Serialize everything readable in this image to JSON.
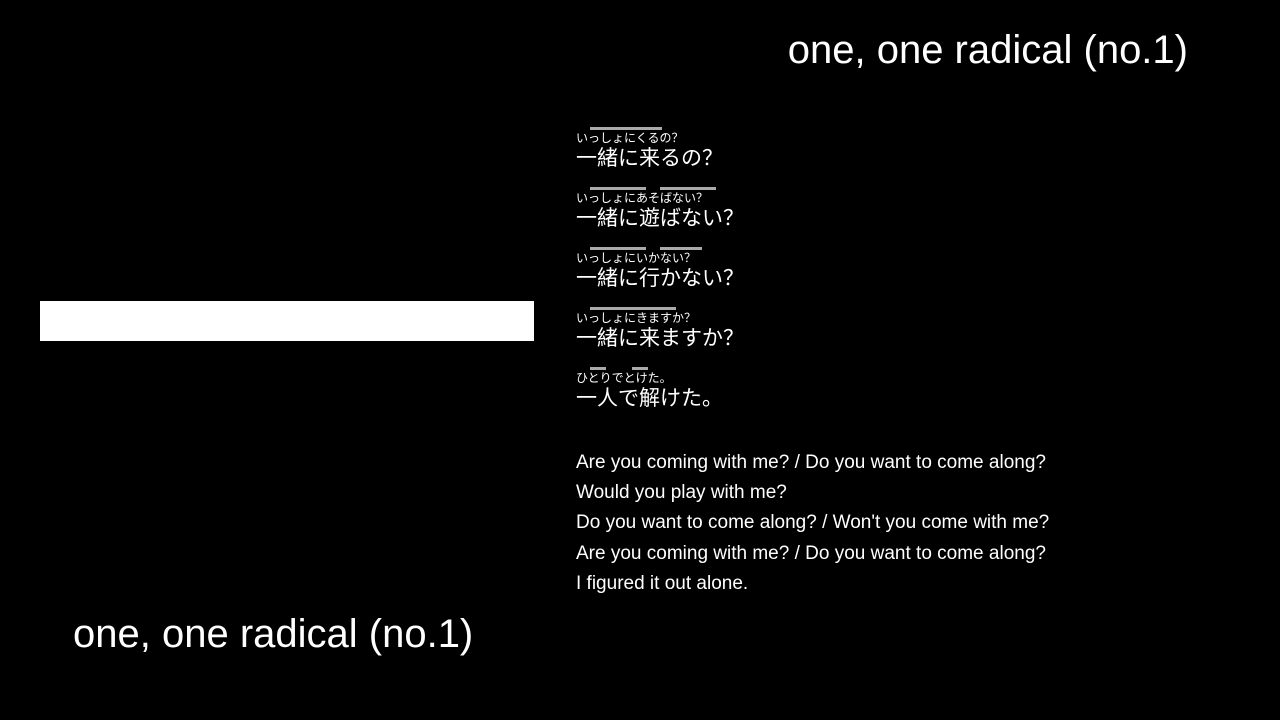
{
  "title": "one, one radical (no.1)",
  "sentences": [
    {
      "reading": "いっしょにくるの？",
      "text": "一緒に来るの？"
    },
    {
      "reading": "いっしょにあそばない？",
      "text": "一緒に遊ばない？"
    },
    {
      "reading": "いっしょにいかない？",
      "text": "一緒に行かない？"
    },
    {
      "reading": "いっしょにきますか？",
      "text": "一緒に来ますか？"
    },
    {
      "reading": "ひとりでとけた。",
      "text": "一人で解けた。"
    }
  ],
  "translations": [
    "Are you coming with me? / Do you want to come along?",
    "Would you play with me?",
    "Do you want to come along? / Won't you come with me?",
    "Are you coming with me? / Do you want to come along?",
    "I figured it out alone."
  ]
}
